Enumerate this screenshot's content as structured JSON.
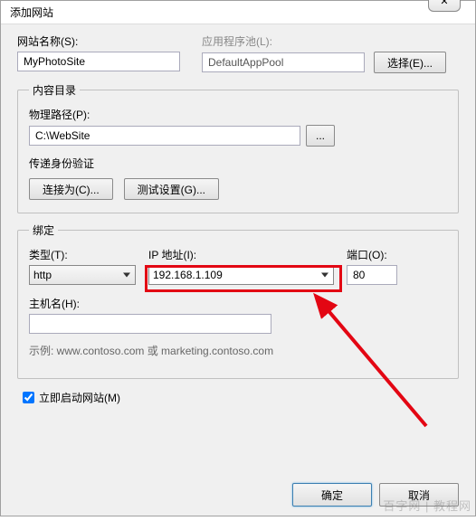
{
  "dialog": {
    "title": "添加网站",
    "close_symbol": "✕"
  },
  "site": {
    "name_label": "网站名称(S):",
    "name_value": "MyPhotoSite",
    "apppool_label": "应用程序池(L):",
    "apppool_value": "DefaultAppPool",
    "select_btn": "选择(E)..."
  },
  "content_dir": {
    "legend": "内容目录",
    "path_label": "物理路径(P):",
    "path_value": "C:\\WebSite",
    "browse_btn": "...",
    "auth_label": "传递身份验证",
    "connect_btn": "连接为(C)...",
    "test_btn": "测试设置(G)..."
  },
  "binding": {
    "legend": "绑定",
    "type_label": "类型(T):",
    "type_value": "http",
    "ip_label": "IP 地址(I):",
    "ip_value": "192.168.1.109",
    "port_label": "端口(O):",
    "port_value": "80",
    "host_label": "主机名(H):",
    "host_value": "",
    "example": "示例: www.contoso.com 或 marketing.contoso.com"
  },
  "start_immediately": {
    "label": "立即启动网站(M)",
    "checked": true
  },
  "footer": {
    "ok": "确定",
    "cancel": "取消"
  },
  "watermark": "百字网 | 教程网",
  "highlight": {
    "color": "#e30613"
  }
}
